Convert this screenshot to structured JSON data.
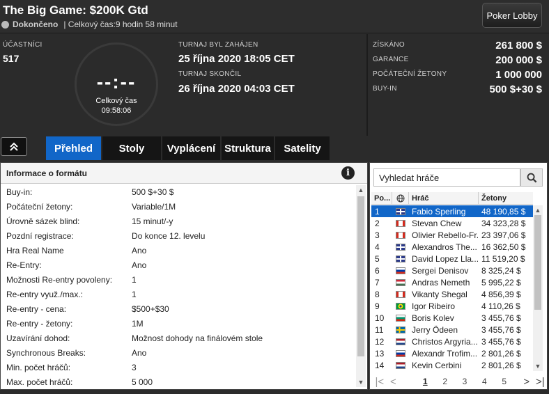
{
  "header": {
    "title": "The Big Game: $200K Gtd",
    "status": "Dokončeno",
    "total_time_text": "| Celkový čas:9 hodin  58 minut",
    "lobby_button": "Poker Lobby"
  },
  "stats": {
    "participants_label": "ÚČASTNÍCI",
    "participants_value": "517",
    "clock_digits": "--:--",
    "clock_label": "Celkový čas",
    "clock_time": "09:58:06",
    "started_label": "TURNAJ BYL ZAHÁJEN",
    "started_value": "25 října 2020  18:05 CET",
    "ended_label": "TURNAJ SKONČIL",
    "ended_value": "26 října 2020  04:03 CET"
  },
  "prizes": {
    "won_label": "ZÍSKÁNO",
    "won_value": "261 800 $",
    "guarantee_label": "GARANCE",
    "guarantee_value": "200 000 $",
    "chips_label": "POČÁTEČNÍ ŽETONY",
    "chips_value": "1 000 000",
    "buyin_label": "BUY-IN",
    "buyin_value": "500 $+30 $"
  },
  "tabs": [
    "Přehled",
    "Stoly",
    "Vyplácení",
    "Struktura",
    "Satelity"
  ],
  "format": {
    "title": "Informace o formátu",
    "rows": [
      {
        "key": "Buy-in:",
        "value": "500 $+30 $"
      },
      {
        "key": "Počáteční žetony:",
        "value": "Variable/1M"
      },
      {
        "key": "Úrovně sázek blind:",
        "value": "15 minut/-y"
      },
      {
        "key": "Pozdní registrace:",
        "value": "Do konce 12. levelu"
      },
      {
        "key": "Hra Real Name",
        "value": "Ano"
      },
      {
        "key": "Re-Entry:",
        "value": "Ano"
      },
      {
        "key": "Možnosti Re-entry povoleny:",
        "value": "1"
      },
      {
        "key": "Re-entry využ./max.:",
        "value": "1"
      },
      {
        "key": "Re-entry - cena:",
        "value": "$500+$30"
      },
      {
        "key": "Re-entry - žetony:",
        "value": "1M"
      },
      {
        "key": "Uzavírání dohod:",
        "value": "Možnost dohody na finálovém stole"
      },
      {
        "key": "Synchronous Breaks:",
        "value": "Ano"
      },
      {
        "key": "Min. počet hráčů:",
        "value": "3"
      },
      {
        "key": "Max. počet hráčů:",
        "value": "5 000"
      }
    ]
  },
  "players": {
    "search_placeholder": "Vyhledat hráče",
    "columns": {
      "pos": "Po...",
      "player": "Hráč",
      "chips": "Žetony"
    },
    "rows": [
      {
        "pos": "1",
        "flag": "gb",
        "name": "Fabio Sperling",
        "chips": "48 190,85 $"
      },
      {
        "pos": "2",
        "flag": "ca",
        "name": "Stevan Chew",
        "chips": "34 323,28 $"
      },
      {
        "pos": "3",
        "flag": "ca",
        "name": "Olivier Rebello-Fr...",
        "chips": "23 397,06 $"
      },
      {
        "pos": "4",
        "flag": "gb",
        "name": "Alexandros The...",
        "chips": "16 362,50 $"
      },
      {
        "pos": "5",
        "flag": "gb",
        "name": "David Lopez Lla...",
        "chips": "11 519,20 $"
      },
      {
        "pos": "6",
        "flag": "ru",
        "name": "Sergei Denisov",
        "chips": "8 325,24 $"
      },
      {
        "pos": "7",
        "flag": "hu",
        "name": "Andras Nemeth",
        "chips": "5 995,22 $"
      },
      {
        "pos": "8",
        "flag": "ca",
        "name": "Vikanty Shegal",
        "chips": "4 856,39 $"
      },
      {
        "pos": "9",
        "flag": "br",
        "name": "Igor Ribeiro",
        "chips": "4 110,26 $"
      },
      {
        "pos": "10",
        "flag": "bg",
        "name": "Boris Kolev",
        "chips": "3 455,76 $"
      },
      {
        "pos": "11",
        "flag": "se",
        "name": "Jerry Ödeen",
        "chips": "3 455,76 $"
      },
      {
        "pos": "12",
        "flag": "nl",
        "name": "Christos Argyria...",
        "chips": "3 455,76 $"
      },
      {
        "pos": "13",
        "flag": "ru",
        "name": "Alexandr Trofim...",
        "chips": "2 801,26 $"
      },
      {
        "pos": "14",
        "flag": "nl",
        "name": "Kevin Cerbini",
        "chips": "2 801,26 $"
      }
    ],
    "pages": [
      "1",
      "2",
      "3",
      "4",
      "5"
    ],
    "current_page": "1"
  },
  "colors": {
    "accent": "#1166c8",
    "header_bg": "#2d2d2d",
    "panel_bg": "#ffffff"
  }
}
